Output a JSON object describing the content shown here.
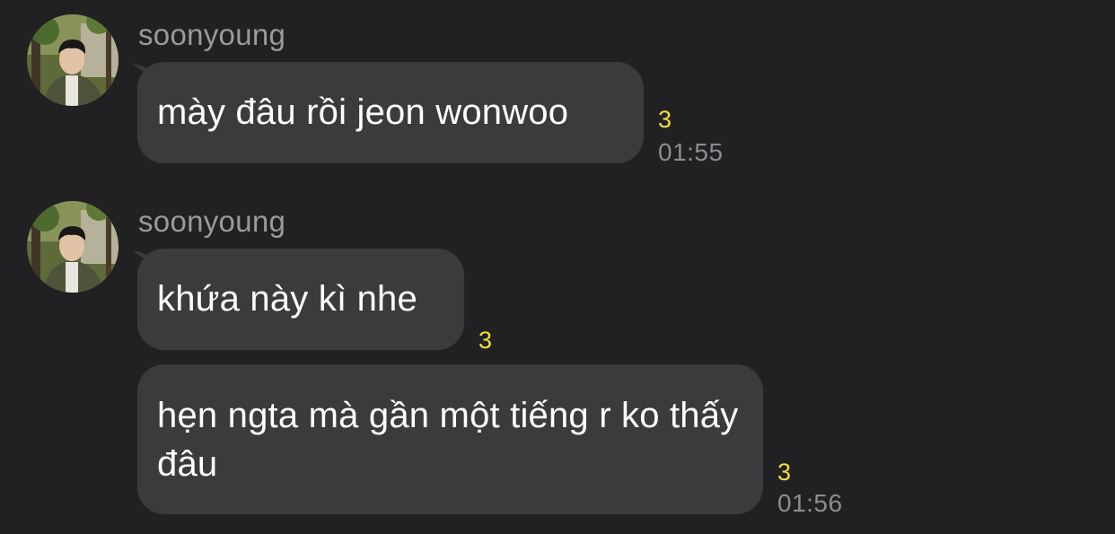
{
  "chat": {
    "messages": [
      {
        "sender": "soonyoung",
        "text": "mày đâu rồi jeon wonwoo",
        "unread": "3",
        "time": "01:55"
      },
      {
        "sender": "soonyoung",
        "text": "khứa này kì nhe",
        "unread": "3"
      },
      {
        "text": "hẹn ngta mà gần một tiếng r ko thấy đâu",
        "unread": "3",
        "time": "01:56"
      }
    ]
  },
  "colors": {
    "background": "#212123",
    "bubble": "#3b3b3d",
    "unread": "#f6dc36",
    "time": "#8c8c90",
    "sender": "#9a9a9e"
  }
}
